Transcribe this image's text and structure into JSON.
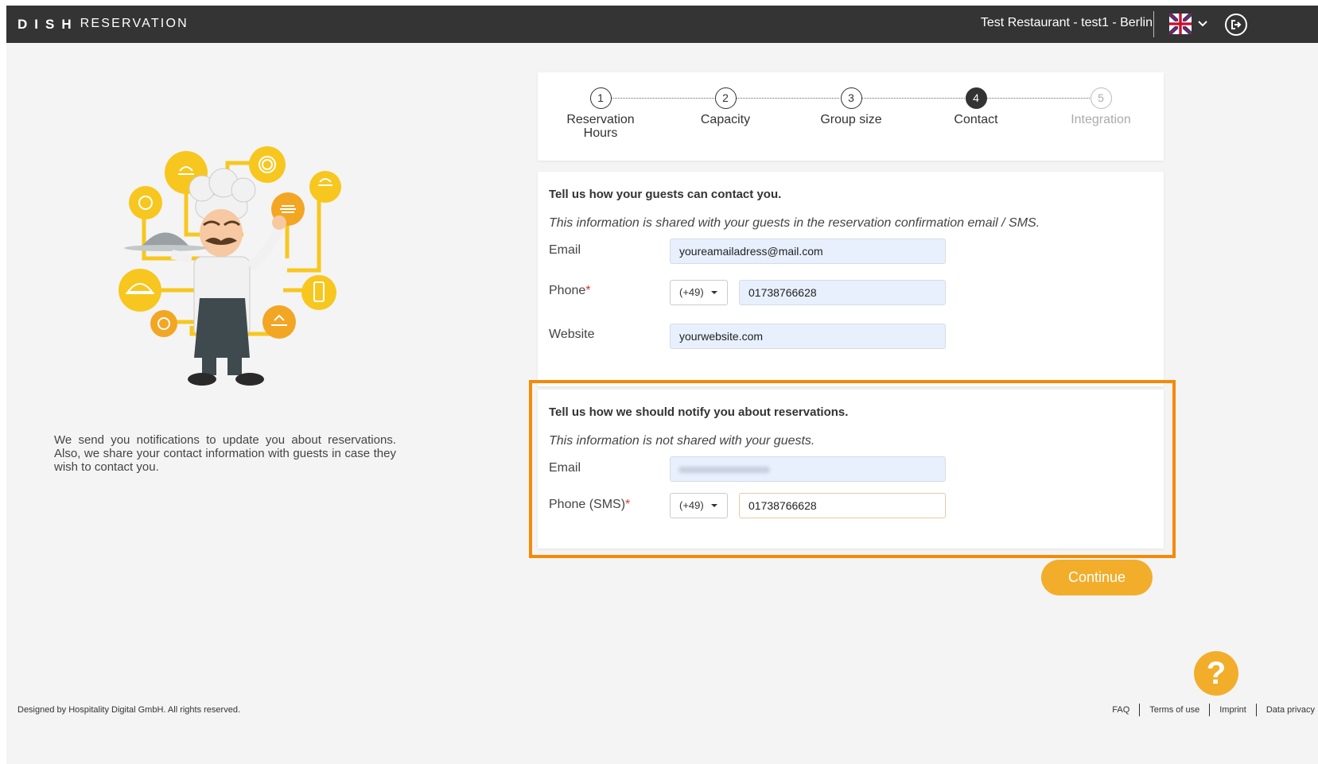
{
  "header": {
    "logo_bold": "DISH",
    "logo_light": "RESERVATION",
    "restaurant": "Test Restaurant - test1 - Berlin",
    "language_icon": "uk-flag-icon",
    "chevron_icon": "chevron-down-icon",
    "logout_icon": "logout-icon"
  },
  "left": {
    "description": "We send you notifications to update you about reservations. Also, we share your contact information with guests in case they wish to contact you."
  },
  "stepper": {
    "steps": [
      {
        "number": "1",
        "label": "Reservation Hours",
        "state": "done"
      },
      {
        "number": "2",
        "label": "Capacity",
        "state": "done"
      },
      {
        "number": "3",
        "label": "Group size",
        "state": "done"
      },
      {
        "number": "4",
        "label": "Contact",
        "state": "active"
      },
      {
        "number": "5",
        "label": "Integration",
        "state": "disabled"
      }
    ]
  },
  "guest_contact": {
    "title": "Tell us how your guests can contact you.",
    "subtitle": "This information is shared with your guests in the reservation confirmation email / SMS.",
    "email_label": "Email",
    "email_value": "youreamailadress@mail.com",
    "phone_label": "Phone",
    "phone_required": "*",
    "phone_code": "(+49)",
    "phone_value": "01738766628",
    "website_label": "Website",
    "website_value": "yourwebsite.com"
  },
  "notify": {
    "title": "Tell us how we should notify you about reservations.",
    "subtitle": "This information is not shared with your guests.",
    "email_label": "Email",
    "phone_label": "Phone (SMS)",
    "phone_required": "*",
    "phone_code": "(+49)",
    "phone_value": "01738766628"
  },
  "actions": {
    "continue_label": "Continue",
    "help_label": "?"
  },
  "footer": {
    "copyright": "Designed by Hospitality Digital GmbH. All rights reserved.",
    "links": [
      "FAQ",
      "Terms of use",
      "Imprint",
      "Data privacy"
    ]
  },
  "colors": {
    "accent": "#f2ae2b",
    "highlight": "#f58a07",
    "topbar": "#343434"
  }
}
